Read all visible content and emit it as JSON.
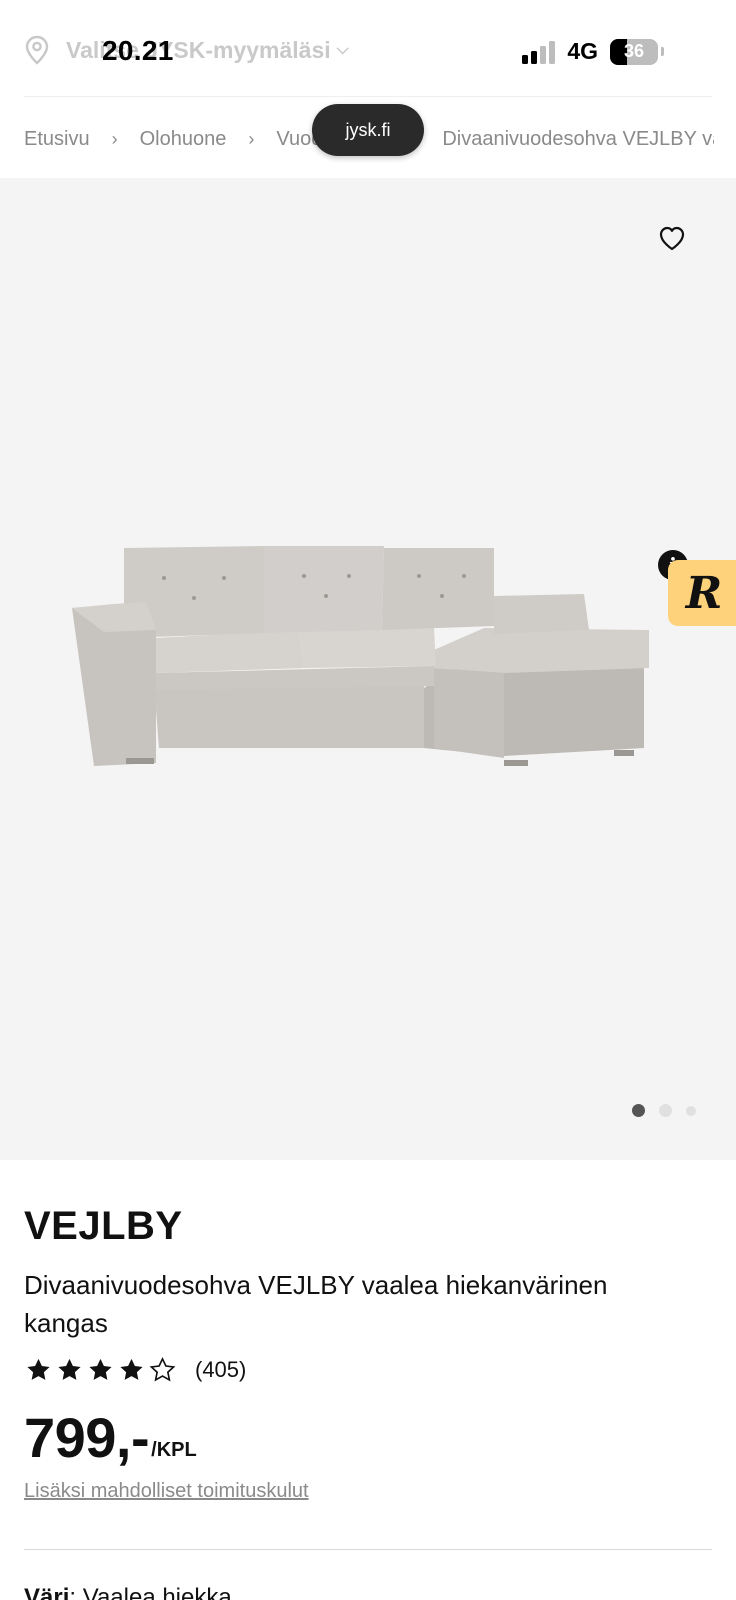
{
  "status_bar": {
    "time": "20.21",
    "network": "4G",
    "battery": "36"
  },
  "store": {
    "label": "Valitse JYSK-myymälä",
    "suffix": "si"
  },
  "browser": {
    "url": "jysk.fi"
  },
  "breadcrumb": {
    "items": [
      "Etusivu",
      "Olohuone",
      "Vuodesohvat",
      "Divaanivuodesohva VEJLBY vaalea hiekanvärinen kangas"
    ]
  },
  "gallery": {
    "image_count": 3,
    "active_index": 0
  },
  "product": {
    "brand": "VEJLBY",
    "description": "Divaanivuodesohva VEJLBY vaalea hiekanvärinen kangas",
    "rating_stars": 4,
    "rating_max": 5,
    "review_count": "(405)",
    "price": "799,-",
    "unit": "/KPL",
    "shipping_note": "Lisäksi mahdolliset toimituskulut",
    "color_label": "Väri",
    "color_value": ": Vaalea hiekka"
  },
  "colors": {
    "gallery_bg": "#f4f4f4",
    "badge_yellow": "#fdd27a",
    "muted_text": "#8a8a8a"
  },
  "icons": {
    "location": "location-pin-icon",
    "favorite": "heart-outline-icon",
    "star": "star-icon"
  }
}
